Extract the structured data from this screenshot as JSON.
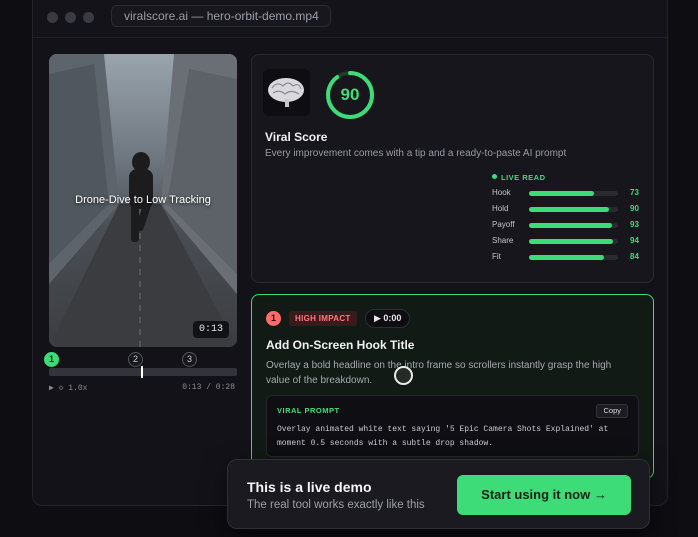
{
  "window": {
    "url_title": "viralscore.ai — hero-orbit-demo.mp4"
  },
  "video": {
    "caption": "Drone-Dive to Low Tracking",
    "timestamp": "0:13",
    "steps": [
      "1",
      "2",
      "3"
    ],
    "active_step": "1",
    "speed": "▶ ◇ 1.0x",
    "timecode": "0:13 / 0:28",
    "progress": 0.46
  },
  "score": {
    "value": "90",
    "value_fraction": 0.9,
    "title": "Viral Score",
    "subtitle": "Every improvement comes with a tip and a ready-to-paste AI prompt",
    "live_label": "LIVE READ",
    "metrics": [
      {
        "label": "Hook",
        "value": "73",
        "fraction": 0.73
      },
      {
        "label": "Hold",
        "value": "90",
        "fraction": 0.9
      },
      {
        "label": "Payoff",
        "value": "93",
        "fraction": 0.93
      },
      {
        "label": "Share",
        "value": "94",
        "fraction": 0.94
      },
      {
        "label": "Fit",
        "value": "84",
        "fraction": 0.84
      }
    ],
    "accent": "#3ddc78"
  },
  "tip": {
    "number": "1",
    "impact": "HIGH IMPACT",
    "time": "▶ 0:00",
    "title": "Add On-Screen Hook Title",
    "body": "Overlay a bold headline on the intro frame so scrollers instantly grasp the high value of the breakdown.",
    "prompt_label": "VIRAL PROMPT",
    "copy_label": "Copy",
    "prompt_text": "Overlay animated white text saying '5 Epic Camera Shots Explained' at moment 0.5 seconds with a subtle drop shadow."
  },
  "cta": {
    "title": "This is a live demo",
    "subtitle": "The real tool works exactly like this",
    "button": "Start using it now →"
  }
}
